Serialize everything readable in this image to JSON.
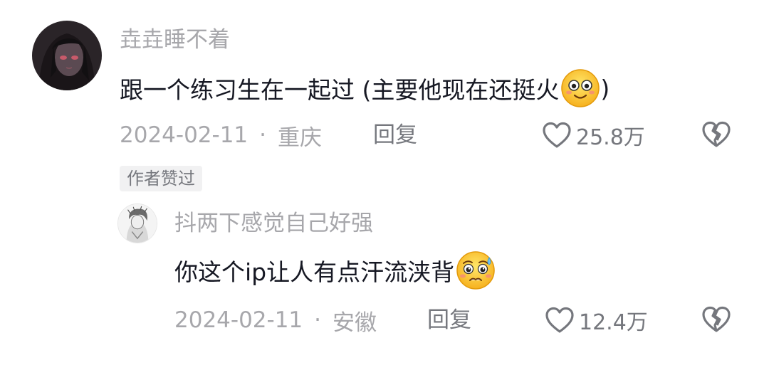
{
  "comments": [
    {
      "username": "垚垚睡不着",
      "text": "跟一个练习生在一起过 (主要他现在还挺火",
      "text_end": ")",
      "emoji": "smiling-face-emoji",
      "date": "2024-02-11",
      "separator": "·",
      "location": "重庆",
      "reply_label": "回复",
      "likes": "25.8万",
      "badge": "作者赞过"
    },
    {
      "username": "抖两下感觉自己好强",
      "text": "你这个ip让人有点汗流浃背",
      "emoji": "pleading-sweat-emoji",
      "date": "2024-02-11",
      "separator": "·",
      "location": "安徽",
      "reply_label": "回复",
      "likes": "12.4万"
    }
  ],
  "colors": {
    "text_primary": "#161823",
    "text_secondary": "#a7a7ab",
    "action_gray": "#75777d",
    "badge_bg": "#f1f1f2"
  }
}
